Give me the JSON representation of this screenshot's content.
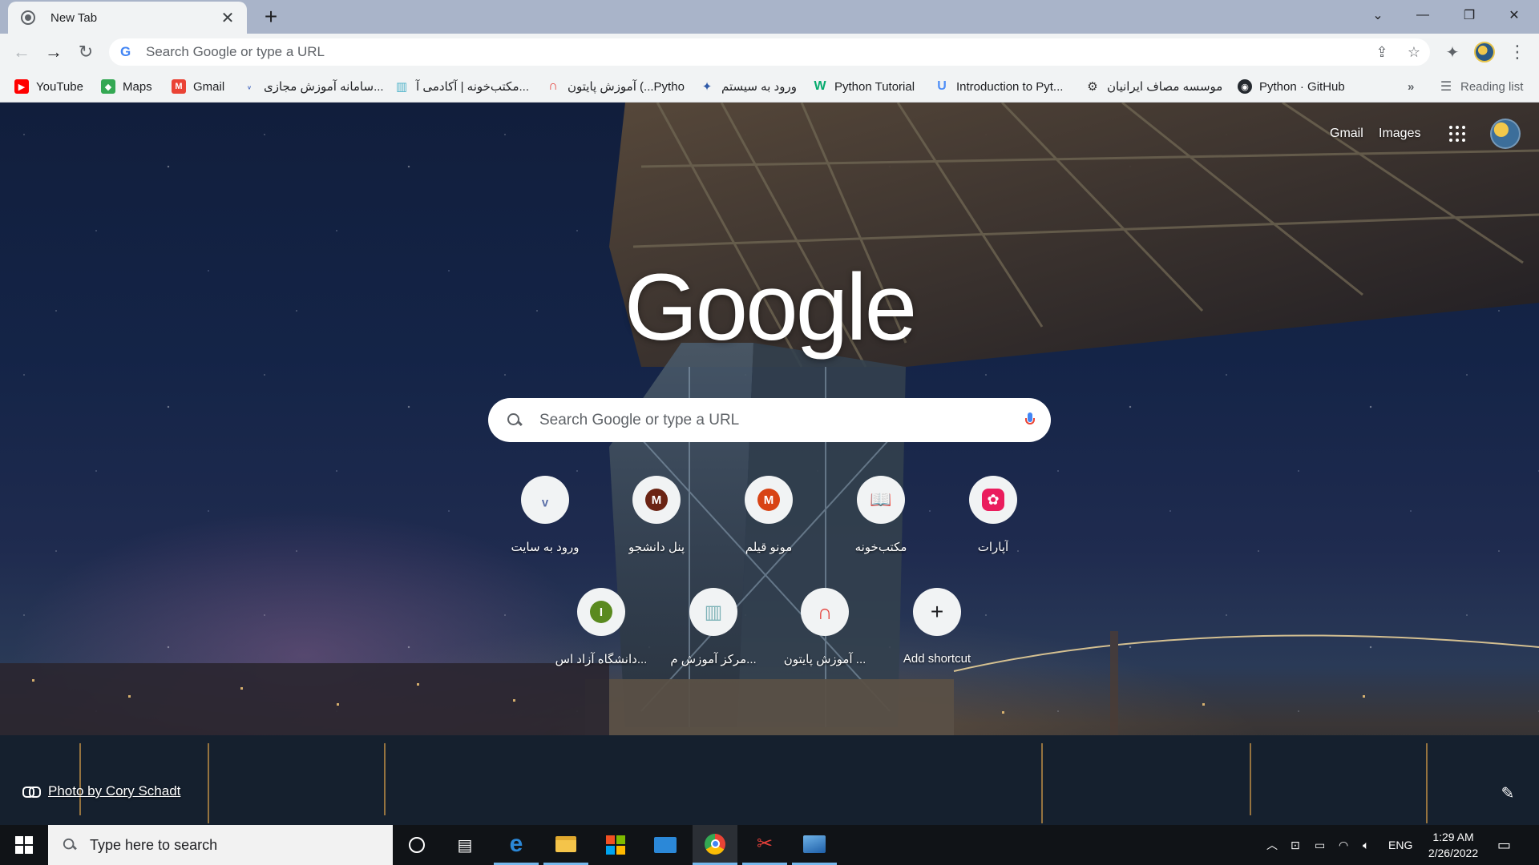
{
  "window": {
    "tab_title": "New Tab",
    "new_tab_symbol": "+"
  },
  "toolbar": {
    "omnibox_placeholder": "Search Google or type a URL"
  },
  "bookmarks": [
    {
      "label": "YouTube",
      "icon": "youtube-icon",
      "color": "#ff0000"
    },
    {
      "label": "Maps",
      "icon": "maps-icon",
      "color": "#34a853"
    },
    {
      "label": "Gmail",
      "icon": "gmail-icon",
      "color": "#ea4335"
    },
    {
      "label": "سامانه آموزش مجازی...",
      "icon": "elearning-icon",
      "color": "#4a6cc2"
    },
    {
      "label": "مکتب‌خونه | آکادمی آ...",
      "icon": "maktabkhooneh-icon",
      "color": "#4fb3c9"
    },
    {
      "label": "آموزش پایتون (...Pytho",
      "icon": "python-course-icon",
      "color": "#e5403a"
    },
    {
      "label": "ورود به سیستم",
      "icon": "login-icon",
      "color": "#2f5aa8"
    },
    {
      "label": "Python Tutorial",
      "icon": "w3schools-icon",
      "color": "#04aa6d"
    },
    {
      "label": "Introduction to Pyt...",
      "icon": "udemy-icon",
      "color": "#4e8ef7"
    },
    {
      "label": "موسسه مصاف ایرانیان",
      "icon": "masaf-icon",
      "color": "#333333"
    },
    {
      "label": "Python · GitHub",
      "icon": "github-icon",
      "color": "#24292f"
    }
  ],
  "bookmarks_overflow": "»",
  "reading_list": "Reading list",
  "ntp": {
    "gmail_link": "Gmail",
    "images_link": "Images",
    "logo_text": "Google",
    "search_placeholder": "Search Google or type a URL",
    "photo_credit": "Photo by Cory Schadt",
    "shortcuts_row1": [
      {
        "label": "ورود به سایت",
        "glyph": "ᵥ",
        "color": "#5b6fa8"
      },
      {
        "label": "پنل دانشجو",
        "glyph": "M",
        "color": "#6b2414"
      },
      {
        "label": "مونو قیلم",
        "glyph": "M",
        "color": "#d84315"
      },
      {
        "label": "مکتب‌خونه",
        "glyph": "📖",
        "color": "#4fb3c9"
      },
      {
        "label": "آپارات",
        "glyph": "✿",
        "color": "#ea1d5d"
      }
    ],
    "shortcuts_row2": [
      {
        "label": "دانشگاه آزاد اس...",
        "glyph": "I",
        "color": "#5a8a1f"
      },
      {
        "label": "مرکز آموزش م...",
        "glyph": "▥",
        "color": "#7fb3b8"
      },
      {
        "label": "آموزش پایتون ...",
        "glyph": "∩",
        "color": "#e5403a"
      },
      {
        "label": "Add shortcut",
        "glyph": "+",
        "color": "#202124"
      }
    ]
  },
  "taskbar": {
    "search_placeholder": "Type here to search",
    "language": "ENG",
    "time": "1:29 AM",
    "date": "2/26/2022",
    "apps": [
      "cortana-icon",
      "task-view-icon",
      "edge-icon",
      "file-explorer-icon",
      "store-icon",
      "mail-icon",
      "chrome-icon",
      "snipping-tool-icon",
      "photos-icon"
    ]
  }
}
